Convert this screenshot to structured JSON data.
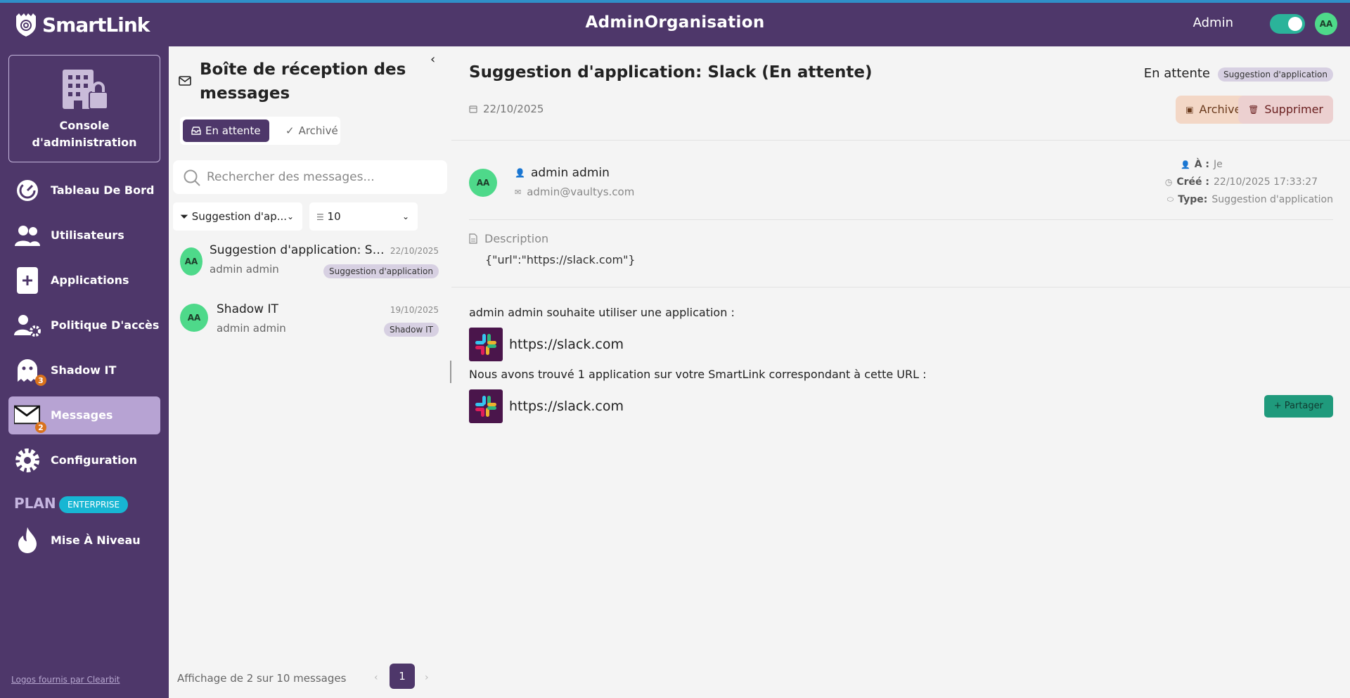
{
  "app": {
    "logo_text": "SmartLink",
    "org_title": "AdminOrganisation",
    "role": "Admin",
    "user_initials": "AA"
  },
  "sidebar": {
    "console_label": "Console d'administration",
    "items": [
      {
        "label": "Tableau De Bord",
        "icon": "gauge-icon"
      },
      {
        "label": "Utilisateurs",
        "icon": "users-icon"
      },
      {
        "label": "Applications",
        "icon": "plus-square-icon"
      },
      {
        "label": "Politique D'accès",
        "icon": "user-gear-icon"
      },
      {
        "label": "Shadow IT",
        "icon": "ghost-icon",
        "badge": "3"
      },
      {
        "label": "Messages",
        "icon": "envelope-icon",
        "badge": "2",
        "active": true
      },
      {
        "label": "Configuration",
        "icon": "gear-icon"
      }
    ],
    "plan_label": "PLAN",
    "plan_badge": "ENTERPRISE",
    "upgrade_label": "Mise À Niveau",
    "credit": "Logos fournis par Clearbit"
  },
  "inbox": {
    "title": "Boîte de réception des messages",
    "tab_pending": "En attente",
    "tab_archived": "Archivé",
    "search_placeholder": "Rechercher des messages...",
    "filter_type": "Suggestion d'ap...",
    "filter_per_page": "10",
    "messages": [
      {
        "initials": "AA",
        "title": "Suggestion d'application: Slack (En attente)",
        "date": "22/10/2025",
        "from": "admin admin",
        "tag": "Suggestion d'application"
      },
      {
        "initials": "AA",
        "title": "Shadow IT",
        "date": "19/10/2025",
        "from": "admin admin",
        "tag": "Shadow IT"
      }
    ],
    "footer": "Affichage de 2 sur 10 messages",
    "current_page": "1"
  },
  "detail": {
    "title": "Suggestion d'application: Slack (En attente)",
    "status": "En attente",
    "status_tag": "Suggestion d'application",
    "date": "22/10/2025",
    "archive_label": "Archiver",
    "delete_label": "Supprimer",
    "sender_initials": "AA",
    "sender_name": "admin admin",
    "sender_email": "admin@vaultys.com",
    "to_label": "À :",
    "to_value": "Je",
    "created_label": "Créé :",
    "created_value": "22/10/2025 17:33:27",
    "type_label": "Type:",
    "type_value": "Suggestion d'application",
    "description_label": "Description",
    "description_value": "{\"url\":\"https://slack.com\"}",
    "intro": "admin admin souhaite utiliser une application :",
    "app_url": "https://slack.com",
    "found_text": "Nous avons trouvé 1 application sur votre SmartLink correspondant à cette URL :",
    "found_url": "https://slack.com",
    "share_label": "Partager"
  },
  "colors": {
    "brand": "#4e376a",
    "accent_green": "#2bb39a",
    "avatar": "#4ed98a",
    "badge": "#d9721c",
    "plan_badge": "#17b6d3"
  }
}
